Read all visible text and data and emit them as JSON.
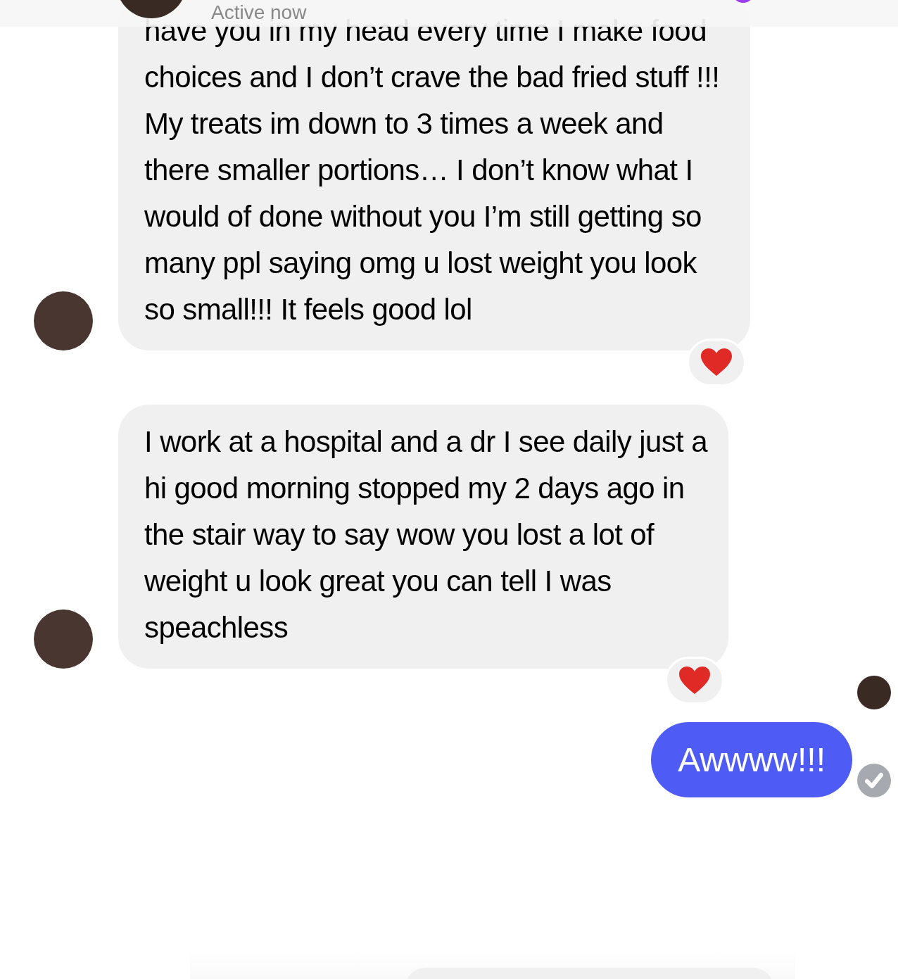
{
  "header": {
    "status_text": "Active now"
  },
  "messages": [
    {
      "kind": "incoming",
      "text": "have you in my head every time I make food choices and I don’t crave the bad fried stuff !!! My treats im down to 3 times a week and there smaller portions… I don’t know what I would of done without you I’m still getting so many ppl saying omg u lost weight you look so small!!! It feels good lol",
      "reacted": true
    },
    {
      "kind": "incoming",
      "text": "I work at a hospital and a dr I see daily just a hi good morning stopped my 2 days ago in the stair way to say wow you lost a lot of weight u look great you can tell I was speachless",
      "reacted": true
    },
    {
      "kind": "outgoing",
      "text": "Awwww!!!",
      "seen": true,
      "delivered": true
    }
  ]
}
